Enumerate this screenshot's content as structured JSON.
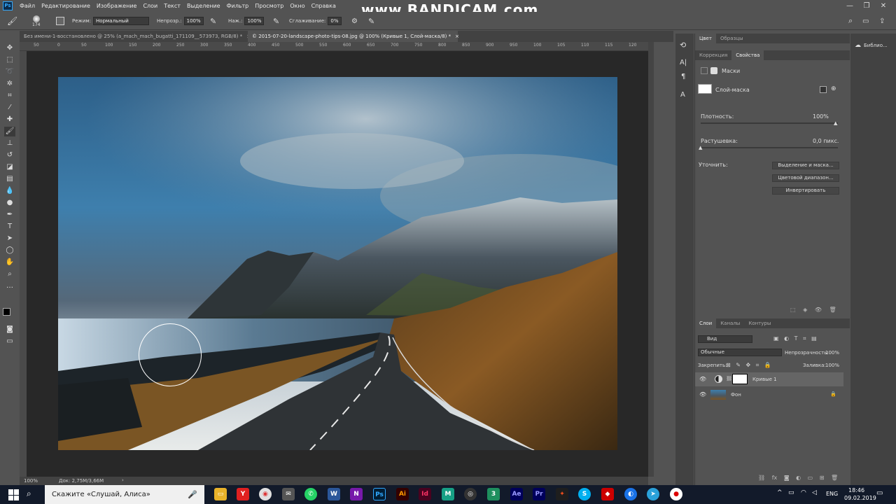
{
  "menubar": {
    "items": [
      "Файл",
      "Редактирование",
      "Изображение",
      "Слои",
      "Текст",
      "Выделение",
      "Фильтр",
      "Просмотр",
      "Окно",
      "Справка"
    ],
    "watermark": "www.BANDICAM.com",
    "ps_logo": "Ps"
  },
  "options": {
    "brush_size": "174",
    "mode_label": "Режим:",
    "mode_value": "Нормальный",
    "opacity_label": "Непрозр.:",
    "opacity_value": "100%",
    "pressure_label": "Наж.:",
    "pressure_value": "100%",
    "smoothing_label": "Сглаживание:",
    "smoothing_value": "0%"
  },
  "tabs": [
    {
      "label": "Без имени-1-восстановлено @ 25% (a_mach_mach_bugatti_171109__573973, RGB/8) *"
    },
    {
      "label": "© 2015-07-20-landscape-photo-tips-08.jpg @ 100% (Кривые 1, Слой-маска/8) *"
    }
  ],
  "ruler_ticks": [
    "50",
    "0",
    "50",
    "100",
    "150",
    "200",
    "250",
    "300",
    "350",
    "400",
    "450",
    "500",
    "550",
    "600",
    "650",
    "700",
    "750",
    "800",
    "850",
    "900",
    "950",
    "100",
    "105",
    "110",
    "115",
    "120"
  ],
  "status": {
    "zoom": "100%",
    "doc": "Док: 2,75M/3,66M"
  },
  "colors": {
    "accent": "#31a8ff",
    "panel": "#535353",
    "canvas": "#282828"
  },
  "properties": {
    "tabs": [
      "Цвет",
      "Образцы"
    ],
    "subtabs": [
      "Коррекция",
      "Свойства"
    ],
    "masks_label": "Маски",
    "layer_mask_label": "Слой-маска",
    "density_label": "Плотность:",
    "density_value": "100%",
    "feather_label": "Растушевка:",
    "feather_value": "0,0 пикс.",
    "refine_label": "Уточнить:",
    "btn_select_mask": "Выделение и маска...",
    "btn_color_range": "Цветовой диапазон...",
    "btn_invert": "Инвертировать"
  },
  "layers_panel": {
    "tabs": [
      "Слои",
      "Каналы",
      "Контуры"
    ],
    "filter_label": "Вид",
    "blend_mode": "Обычные",
    "opacity_label": "Непрозрачность:",
    "opacity_value": "100%",
    "lock_label": "Закрепить:",
    "fill_label": "Заливка:",
    "fill_value": "100%",
    "layers": [
      {
        "name": "Кривые 1"
      },
      {
        "name": "Фон"
      }
    ]
  },
  "right_strip": {
    "library_label": "Библио..."
  },
  "taskbar": {
    "search_placeholder": "Скажите «Слушай, Алиса»",
    "lang": "ENG",
    "time": "18:46",
    "date": "09.02.2019"
  }
}
